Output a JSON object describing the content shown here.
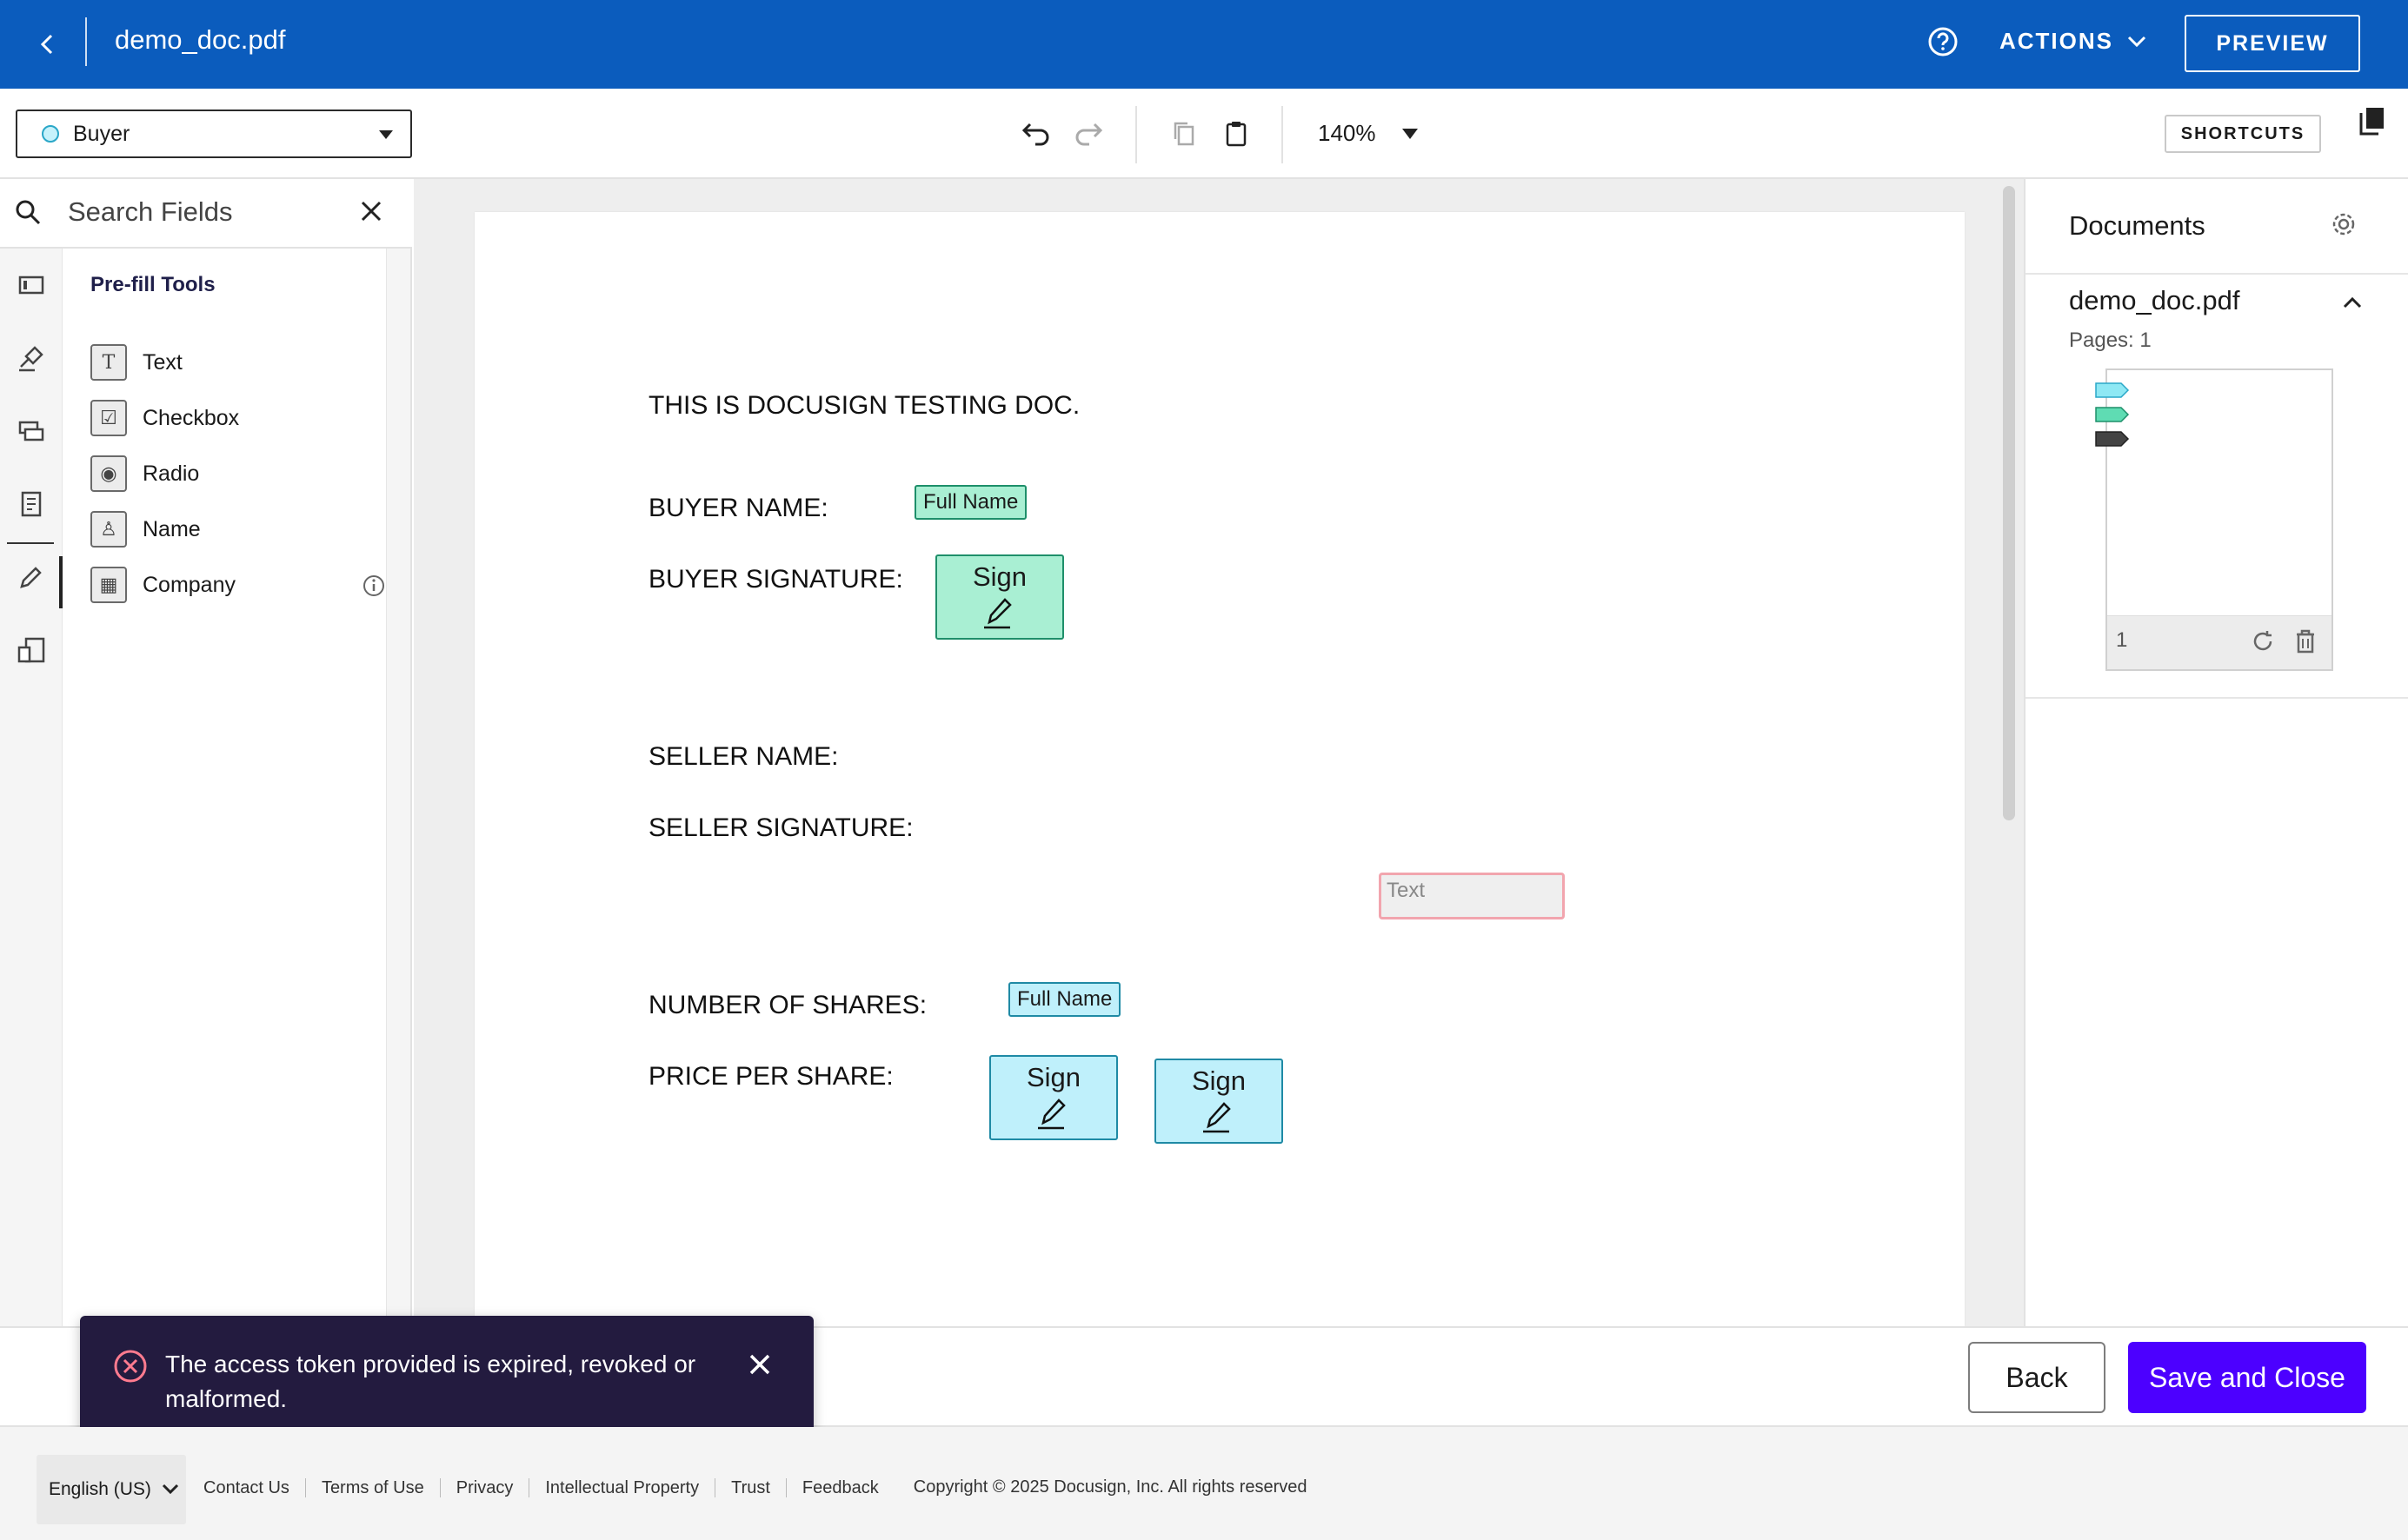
{
  "header": {
    "title": "demo_doc.pdf",
    "actions_label": "ACTIONS",
    "preview_label": "PREVIEW"
  },
  "toolbar": {
    "recipient": "Buyer",
    "zoom": "140%",
    "shortcuts_label": "SHORTCUTS"
  },
  "sidebar": {
    "search_placeholder": "Search Fields",
    "section_title": "Pre-fill Tools",
    "items": [
      {
        "label": "Text",
        "glyph": "T"
      },
      {
        "label": "Checkbox",
        "glyph": "☑"
      },
      {
        "label": "Radio",
        "glyph": "◉"
      },
      {
        "label": "Name",
        "glyph": "♙"
      },
      {
        "label": "Company",
        "glyph": "▦"
      }
    ]
  },
  "document": {
    "heading": "THIS IS DOCUSIGN TESTING DOC.",
    "buyer_name_label": "BUYER NAME:",
    "buyer_signature_label": "BUYER SIGNATURE:",
    "seller_name_label": "SELLER NAME:",
    "seller_signature_label": "SELLER SIGNATURE:",
    "shares_label": "NUMBER OF SHARES:",
    "price_label": "PRICE PER SHARE:",
    "fields": {
      "full_name_1": "Full Name",
      "sign_1": "Sign",
      "text_field": "Text",
      "full_name_2": "Full Name",
      "sign_2": "Sign",
      "sign_3": "Sign"
    }
  },
  "documents_panel": {
    "title": "Documents",
    "doc_name": "demo_doc.pdf",
    "pages_label": "Pages: 1",
    "page_number": "1"
  },
  "actions": {
    "back_label": "Back",
    "save_label": "Save and Close"
  },
  "toast": {
    "message": "The access token provided is expired, revoked or malformed."
  },
  "footer": {
    "language": "English (US)",
    "links": [
      "Contact Us",
      "Terms of Use",
      "Privacy",
      "Intellectual Property",
      "Trust",
      "Feedback"
    ],
    "copyright": "Copyright © 2025 Docusign, Inc. All rights reserved"
  },
  "colors": {
    "header_bg": "#0b5cbd",
    "primary_button": "#4c00ff",
    "buyer_field": "#a9efd3",
    "seller_field": "#bff0fb",
    "toast_bg": "#231b3f"
  }
}
